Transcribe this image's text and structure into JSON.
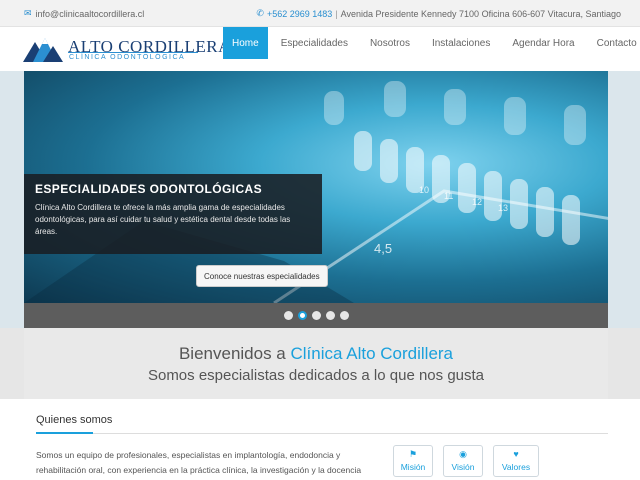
{
  "topbar": {
    "email_icon": "envelope-icon",
    "email": "info@clinicaaltocordillera.cl",
    "phone_icon": "phone-icon",
    "phone": "+562 2969 1483",
    "separator": "|",
    "address": "Avenida Presidente Kennedy 7100 Oficina 606-607 Vitacura, Santiago"
  },
  "logo": {
    "name": "ALTO CORDILLERA",
    "subtitle": "CLÍNICA ODONTOLÓGICA"
  },
  "nav": {
    "items": [
      {
        "label": "Home",
        "active": true
      },
      {
        "label": "Especialidades"
      },
      {
        "label": "Nosotros"
      },
      {
        "label": "Instalaciones"
      },
      {
        "label": "Agendar Hora"
      },
      {
        "label": "Contacto"
      }
    ]
  },
  "hero": {
    "title": "ESPECIALIDADES ODONTOLÓGICAS",
    "text": "Clínica Alto Cordillera te ofrece la más amplia gama de especialidades odontológicas, para así cuidar tu salud y estética dental desde todas las áreas.",
    "cta_label": "Conoce nuestras especialidades",
    "slide_count": 5,
    "active_slide": 2
  },
  "welcome": {
    "line1_prefix": "Bienvenidos a ",
    "line1_highlight": "Clínica Alto Cordillera",
    "line2": "Somos especialistas dedicados a lo que nos gusta"
  },
  "about": {
    "heading": "Quienes somos",
    "text": "Somos un equipo de profesionales, especialistas en implantología, endodoncia y rehabilitación oral, con experiencia en la práctica clínica, la investigación y la docencia",
    "pills": [
      {
        "label": "Misión",
        "icon": "flag-icon"
      },
      {
        "label": "Visión",
        "icon": "eye-icon"
      },
      {
        "label": "Valores",
        "icon": "heart-icon"
      }
    ]
  },
  "colors": {
    "accent": "#1aa0dc",
    "brand_dark": "#1a3f74",
    "caption_bg": "#191e23"
  }
}
